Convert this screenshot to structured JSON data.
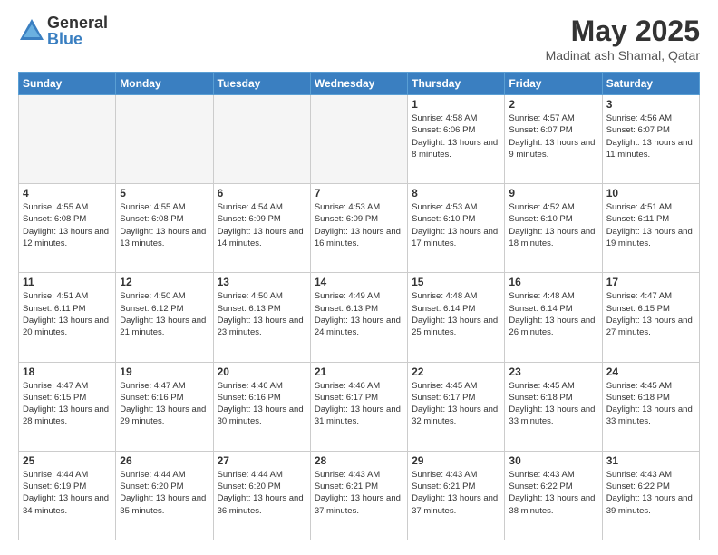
{
  "logo": {
    "general": "General",
    "blue": "Blue"
  },
  "title": {
    "month_year": "May 2025",
    "location": "Madinat ash Shamal, Qatar"
  },
  "days_of_week": [
    "Sunday",
    "Monday",
    "Tuesday",
    "Wednesday",
    "Thursday",
    "Friday",
    "Saturday"
  ],
  "weeks": [
    [
      {
        "day": "",
        "info": ""
      },
      {
        "day": "",
        "info": ""
      },
      {
        "day": "",
        "info": ""
      },
      {
        "day": "",
        "info": ""
      },
      {
        "day": "1",
        "info": "Sunrise: 4:58 AM\nSunset: 6:06 PM\nDaylight: 13 hours\nand 8 minutes."
      },
      {
        "day": "2",
        "info": "Sunrise: 4:57 AM\nSunset: 6:07 PM\nDaylight: 13 hours\nand 9 minutes."
      },
      {
        "day": "3",
        "info": "Sunrise: 4:56 AM\nSunset: 6:07 PM\nDaylight: 13 hours\nand 11 minutes."
      }
    ],
    [
      {
        "day": "4",
        "info": "Sunrise: 4:55 AM\nSunset: 6:08 PM\nDaylight: 13 hours\nand 12 minutes."
      },
      {
        "day": "5",
        "info": "Sunrise: 4:55 AM\nSunset: 6:08 PM\nDaylight: 13 hours\nand 13 minutes."
      },
      {
        "day": "6",
        "info": "Sunrise: 4:54 AM\nSunset: 6:09 PM\nDaylight: 13 hours\nand 14 minutes."
      },
      {
        "day": "7",
        "info": "Sunrise: 4:53 AM\nSunset: 6:09 PM\nDaylight: 13 hours\nand 16 minutes."
      },
      {
        "day": "8",
        "info": "Sunrise: 4:53 AM\nSunset: 6:10 PM\nDaylight: 13 hours\nand 17 minutes."
      },
      {
        "day": "9",
        "info": "Sunrise: 4:52 AM\nSunset: 6:10 PM\nDaylight: 13 hours\nand 18 minutes."
      },
      {
        "day": "10",
        "info": "Sunrise: 4:51 AM\nSunset: 6:11 PM\nDaylight: 13 hours\nand 19 minutes."
      }
    ],
    [
      {
        "day": "11",
        "info": "Sunrise: 4:51 AM\nSunset: 6:11 PM\nDaylight: 13 hours\nand 20 minutes."
      },
      {
        "day": "12",
        "info": "Sunrise: 4:50 AM\nSunset: 6:12 PM\nDaylight: 13 hours\nand 21 minutes."
      },
      {
        "day": "13",
        "info": "Sunrise: 4:50 AM\nSunset: 6:13 PM\nDaylight: 13 hours\nand 23 minutes."
      },
      {
        "day": "14",
        "info": "Sunrise: 4:49 AM\nSunset: 6:13 PM\nDaylight: 13 hours\nand 24 minutes."
      },
      {
        "day": "15",
        "info": "Sunrise: 4:48 AM\nSunset: 6:14 PM\nDaylight: 13 hours\nand 25 minutes."
      },
      {
        "day": "16",
        "info": "Sunrise: 4:48 AM\nSunset: 6:14 PM\nDaylight: 13 hours\nand 26 minutes."
      },
      {
        "day": "17",
        "info": "Sunrise: 4:47 AM\nSunset: 6:15 PM\nDaylight: 13 hours\nand 27 minutes."
      }
    ],
    [
      {
        "day": "18",
        "info": "Sunrise: 4:47 AM\nSunset: 6:15 PM\nDaylight: 13 hours\nand 28 minutes."
      },
      {
        "day": "19",
        "info": "Sunrise: 4:47 AM\nSunset: 6:16 PM\nDaylight: 13 hours\nand 29 minutes."
      },
      {
        "day": "20",
        "info": "Sunrise: 4:46 AM\nSunset: 6:16 PM\nDaylight: 13 hours\nand 30 minutes."
      },
      {
        "day": "21",
        "info": "Sunrise: 4:46 AM\nSunset: 6:17 PM\nDaylight: 13 hours\nand 31 minutes."
      },
      {
        "day": "22",
        "info": "Sunrise: 4:45 AM\nSunset: 6:17 PM\nDaylight: 13 hours\nand 32 minutes."
      },
      {
        "day": "23",
        "info": "Sunrise: 4:45 AM\nSunset: 6:18 PM\nDaylight: 13 hours\nand 33 minutes."
      },
      {
        "day": "24",
        "info": "Sunrise: 4:45 AM\nSunset: 6:18 PM\nDaylight: 13 hours\nand 33 minutes."
      }
    ],
    [
      {
        "day": "25",
        "info": "Sunrise: 4:44 AM\nSunset: 6:19 PM\nDaylight: 13 hours\nand 34 minutes."
      },
      {
        "day": "26",
        "info": "Sunrise: 4:44 AM\nSunset: 6:20 PM\nDaylight: 13 hours\nand 35 minutes."
      },
      {
        "day": "27",
        "info": "Sunrise: 4:44 AM\nSunset: 6:20 PM\nDaylight: 13 hours\nand 36 minutes."
      },
      {
        "day": "28",
        "info": "Sunrise: 4:43 AM\nSunset: 6:21 PM\nDaylight: 13 hours\nand 37 minutes."
      },
      {
        "day": "29",
        "info": "Sunrise: 4:43 AM\nSunset: 6:21 PM\nDaylight: 13 hours\nand 37 minutes."
      },
      {
        "day": "30",
        "info": "Sunrise: 4:43 AM\nSunset: 6:22 PM\nDaylight: 13 hours\nand 38 minutes."
      },
      {
        "day": "31",
        "info": "Sunrise: 4:43 AM\nSunset: 6:22 PM\nDaylight: 13 hours\nand 39 minutes."
      }
    ]
  ]
}
